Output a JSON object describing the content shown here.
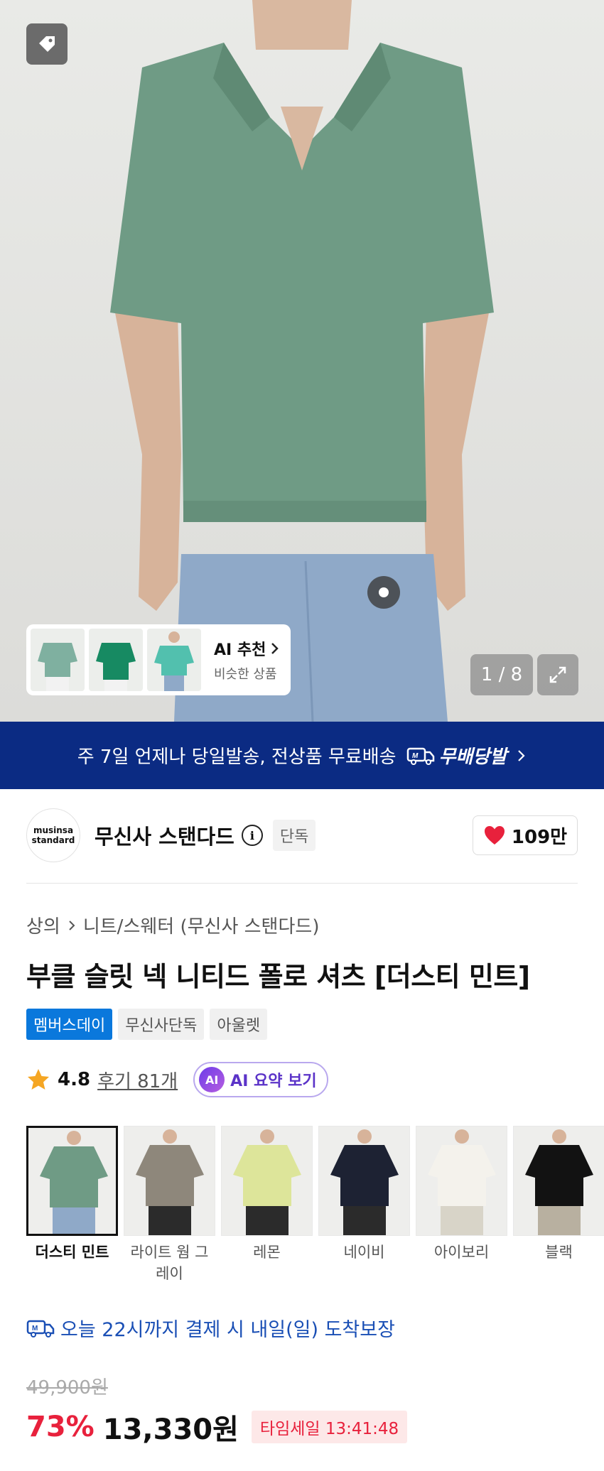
{
  "hero": {
    "counter": "1 / 8",
    "ai_card": {
      "title": "AI 추천",
      "subtitle": "비슷한 상품"
    }
  },
  "banner": {
    "text": "주 7일 언제나 당일발송, 전상품 무료배송",
    "brand": "무배당발"
  },
  "brand": {
    "logo_line1": "musinsa",
    "logo_line2": "standard",
    "name": "무신사 스탠다드",
    "exclusive": "단독",
    "likes": "109만"
  },
  "breadcrumb": {
    "category": "상의",
    "subcategory": "니트/스웨터 (무신사 스탠다드)"
  },
  "product": {
    "title": "부클 슬릿 넥 니티드 폴로 셔츠 [더스티 민트]",
    "badges": [
      "멤버스데이",
      "무신사단독",
      "아울렛"
    ],
    "rating": "4.8",
    "reviews": "후기 81개",
    "ai_summary": "AI 요약 보기",
    "ai_badge": "AI"
  },
  "colors": [
    {
      "label": "더스티 민트",
      "shirt": "#6f9b85",
      "pants": "#8fa9c8"
    },
    {
      "label": "라이트 웜 그레이",
      "shirt": "#8e877b",
      "pants": "#2b2b2b"
    },
    {
      "label": "레몬",
      "shirt": "#dde59a",
      "pants": "#2b2b2b"
    },
    {
      "label": "네이비",
      "shirt": "#1d2233",
      "pants": "#2b2b2b"
    },
    {
      "label": "아이보리",
      "shirt": "#f4f2ec",
      "pants": "#d8d4c8"
    },
    {
      "label": "블랙",
      "shirt": "#121212",
      "pants": "#b8b0a0"
    }
  ],
  "delivery": "오늘 22시까지 결제 시 내일(일) 도착보장",
  "price": {
    "original": "49,900원",
    "discount": "73%",
    "final": "13,330원",
    "timesale": "타임세일 13:41:48"
  }
}
